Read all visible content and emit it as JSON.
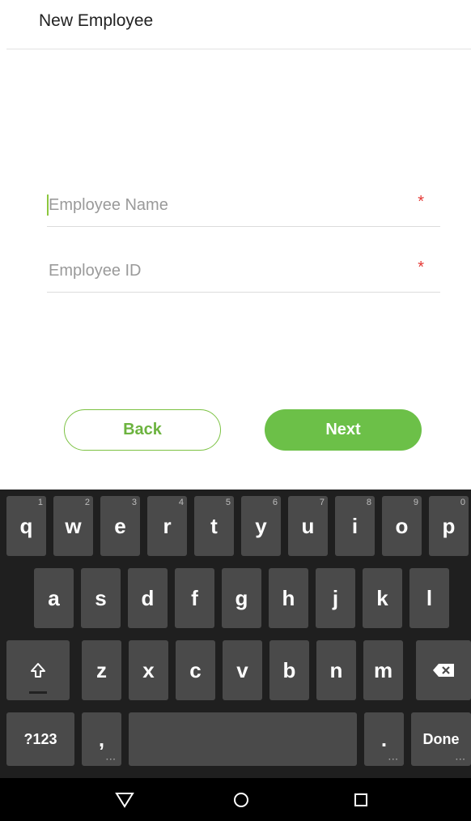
{
  "header": {
    "title": "New Employee"
  },
  "form": {
    "employee_name": {
      "placeholder": "Employee Name",
      "value": "",
      "required_mark": "*"
    },
    "employee_id": {
      "placeholder": "Employee ID",
      "value": "",
      "required_mark": "*"
    }
  },
  "buttons": {
    "back": "Back",
    "next": "Next"
  },
  "colors": {
    "accent": "#6cc048",
    "required": "#e53935",
    "keyboard_bg": "#1f1f1f",
    "key_bg": "#4a4a4a"
  },
  "keyboard": {
    "row1": [
      {
        "label": "q",
        "hint": "1"
      },
      {
        "label": "w",
        "hint": "2"
      },
      {
        "label": "e",
        "hint": "3"
      },
      {
        "label": "r",
        "hint": "4"
      },
      {
        "label": "t",
        "hint": "5"
      },
      {
        "label": "y",
        "hint": "6"
      },
      {
        "label": "u",
        "hint": "7"
      },
      {
        "label": "i",
        "hint": "8"
      },
      {
        "label": "o",
        "hint": "9"
      },
      {
        "label": "p",
        "hint": "0"
      }
    ],
    "row2": [
      "a",
      "s",
      "d",
      "f",
      "g",
      "h",
      "j",
      "k",
      "l"
    ],
    "row3": [
      "z",
      "x",
      "c",
      "v",
      "b",
      "n",
      "m"
    ],
    "symbols": "?123",
    "comma": ",",
    "period": ".",
    "done": "Done",
    "shift_icon": "shift-arrow",
    "backspace_icon": "backspace"
  },
  "navbar": {
    "icons": [
      "back-triangle",
      "home-circle",
      "recents-square"
    ]
  }
}
